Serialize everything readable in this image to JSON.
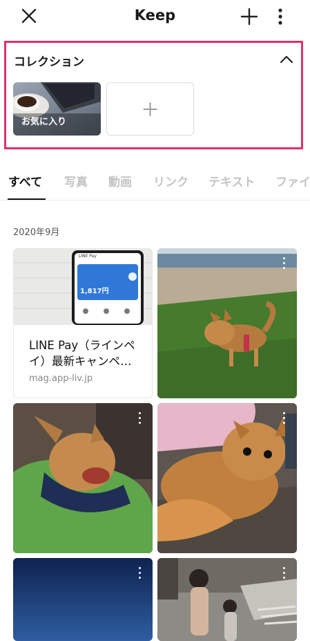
{
  "header": {
    "title": "Keep",
    "icons": {
      "close": "close-icon",
      "add": "plus-icon",
      "more": "more-vertical-icon"
    }
  },
  "collection": {
    "title": "コレクション",
    "toggle_icon": "chevron-up-icon",
    "items": [
      {
        "label": "お気に入り"
      }
    ],
    "add_icon": "plus-icon"
  },
  "tabs": [
    {
      "label": "すべて",
      "active": true
    },
    {
      "label": "写真"
    },
    {
      "label": "動画"
    },
    {
      "label": "リンク"
    },
    {
      "label": "テキスト"
    },
    {
      "label": "ファイ"
    }
  ],
  "section_date": "2020年9月",
  "link_card": {
    "title": "LINE Pay（ラインペイ）最新キャンペ…",
    "domain": "mag.app-liv.jp",
    "thumbnail": {
      "app_name": "LINE Pay",
      "balance": "1,817円"
    }
  },
  "colors": {
    "highlight": "#e0306c",
    "active_tab": "#111111",
    "inactive_tab": "#c4c4c4"
  }
}
